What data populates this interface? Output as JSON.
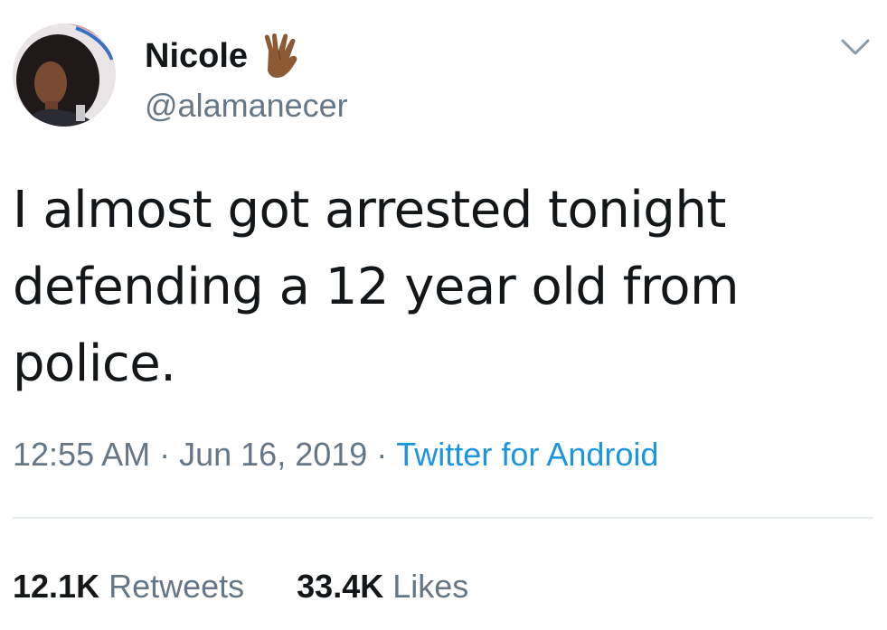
{
  "author": {
    "name": "Nicole",
    "handle": "@alamanecer",
    "name_emoji": "vulcan-salute-icon",
    "avatar": "avatar"
  },
  "tweet": {
    "text": "I almost got arrested tonight defending a 12 year old from police."
  },
  "meta": {
    "time": "12:55 AM",
    "separator": "·",
    "date": "Jun 16, 2019",
    "source": "Twitter for Android"
  },
  "stats": {
    "retweets_count": "12.1K",
    "retweets_label": "Retweets",
    "likes_count": "33.4K",
    "likes_label": "Likes"
  },
  "colors": {
    "text": "#14171a",
    "secondary": "#657786",
    "link": "#1b95e0",
    "divider": "#e6ecf0"
  },
  "icons": {
    "menu": "chevron-down-icon"
  }
}
